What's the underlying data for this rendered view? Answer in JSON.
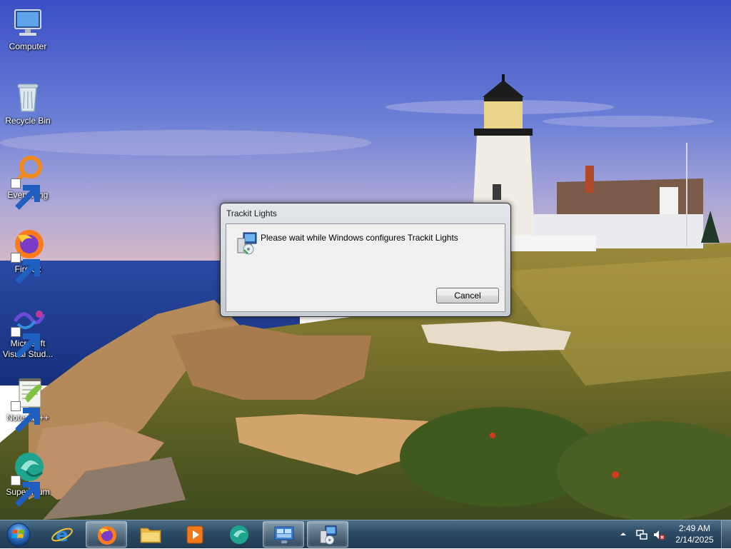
{
  "desktop": {
    "icons": [
      {
        "label": "Computer",
        "icon": "computer-icon",
        "shortcut": false
      },
      {
        "label": "Recycle Bin",
        "icon": "recycle-bin-icon",
        "shortcut": false
      },
      {
        "label": "Everything",
        "icon": "everything-icon",
        "shortcut": true
      },
      {
        "label": "Firefox",
        "icon": "firefox-icon",
        "shortcut": true
      },
      {
        "label": "Microsoft Visual Stud...",
        "icon": "visual-studio-icon",
        "shortcut": true
      },
      {
        "label": "Notepad++",
        "icon": "notepad-plus-plus-icon",
        "shortcut": true
      },
      {
        "label": "Supermium",
        "icon": "supermium-icon",
        "shortcut": true
      }
    ]
  },
  "dialog": {
    "title": "Trackit Lights",
    "icon": "windows-installer-icon",
    "message": "Please wait while Windows configures Trackit Lights",
    "cancel_label": "Cancel"
  },
  "taskbar": {
    "start_icon": "windows-start-icon",
    "pinned": [
      {
        "name": "internet-explorer",
        "icon": "internet-explorer-icon",
        "active": false
      },
      {
        "name": "firefox",
        "icon": "firefox-icon",
        "active": true
      },
      {
        "name": "file-explorer",
        "icon": "folder-icon",
        "active": false
      },
      {
        "name": "media-player",
        "icon": "media-player-icon",
        "active": false
      },
      {
        "name": "supermium",
        "icon": "supermium-icon",
        "active": false
      },
      {
        "name": "remote-desktop",
        "icon": "remote-desktop-icon",
        "active": true
      },
      {
        "name": "windows-installer",
        "icon": "windows-installer-icon",
        "active": true
      }
    ],
    "tray": {
      "chevron_icon": "chevron-up-icon",
      "network_icon": "network-icon",
      "volume_icon": "volume-muted-icon",
      "time": "2:49 AM",
      "date": "2/14/2025"
    }
  },
  "colors": {
    "sky_top": "#3d55c4",
    "sea": "#1d3f8f",
    "grass": "#8f7a2c",
    "taskbar": "#2c4a63"
  }
}
